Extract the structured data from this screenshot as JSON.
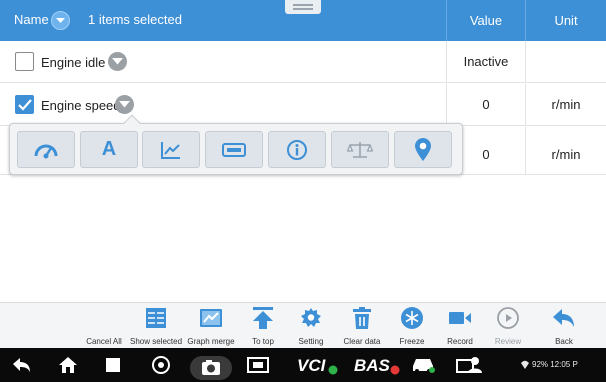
{
  "header": {
    "name_label": "Name",
    "selected_text": "1 items selected",
    "value_col": "Value",
    "unit_col": "Unit",
    "color": "#3d8fd6"
  },
  "rows": [
    {
      "name": "Engine idle",
      "checked": false,
      "value": "Inactive",
      "unit": ""
    },
    {
      "name": "Engine speed",
      "checked": true,
      "value": "0",
      "unit": "r/min"
    },
    {
      "name": "",
      "checked": false,
      "value": "0",
      "unit": "r/min"
    }
  ],
  "popup": {
    "buttons": [
      {
        "icon": "gauge-icon"
      },
      {
        "icon": "text-icon",
        "glyph": "A"
      },
      {
        "icon": "line-chart-icon"
      },
      {
        "icon": "digital-display-icon"
      },
      {
        "icon": "info-icon"
      },
      {
        "icon": "balance-scale-icon"
      },
      {
        "icon": "location-pin-icon"
      }
    ]
  },
  "toolbar": {
    "items": [
      {
        "label": "Cancel All",
        "icon": "none"
      },
      {
        "label": "Show selected",
        "icon": "show-selected-icon"
      },
      {
        "label": "Graph merge",
        "icon": "graph-merge-icon"
      },
      {
        "label": "To top",
        "icon": "to-top-icon"
      },
      {
        "label": "Setting",
        "icon": "gear-icon"
      },
      {
        "label": "Clear data",
        "icon": "trash-icon"
      },
      {
        "label": "Freeze",
        "icon": "snowflake-icon"
      },
      {
        "label": "Record",
        "icon": "record-icon"
      },
      {
        "label": "Review",
        "icon": "play-icon",
        "disabled": true
      },
      {
        "label": "Back",
        "icon": "back-arrow-icon"
      }
    ]
  },
  "navbar": {
    "vci_label": "VCI",
    "bas_label": "BAS",
    "status_text": "92% 12:05 P"
  }
}
